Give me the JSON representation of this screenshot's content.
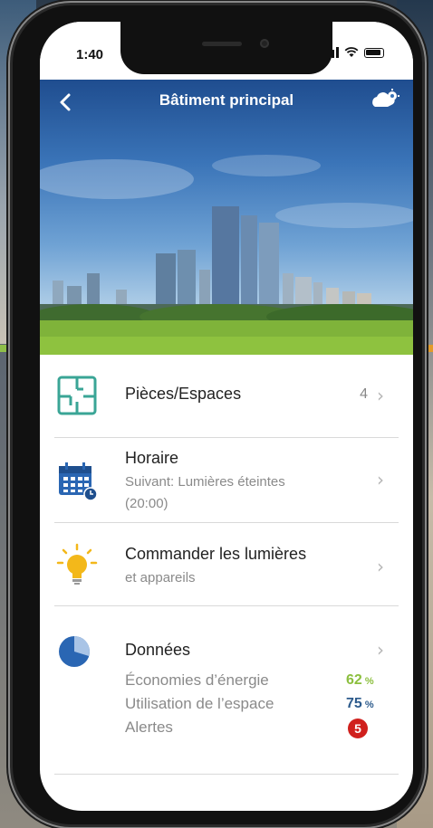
{
  "status": {
    "time": "1:40"
  },
  "header": {
    "title": "Bâtiment principal",
    "back_icon": "chevron-left-icon",
    "settings_icon": "cloud-gear-icon"
  },
  "menu": [
    {
      "title": "Pièces/Espaces",
      "count": "4",
      "icon": "floorplan-icon"
    },
    {
      "title": "Horaire",
      "subtitle_line1": "Suivant: Lumières éteintes",
      "subtitle_line2": "(20:00)",
      "icon": "calendar-icon"
    },
    {
      "title": "Commander les lumières",
      "subtitle": "et appareils",
      "icon": "lightbulb-icon"
    },
    {
      "title": "Données",
      "icon": "pie-chart-icon"
    }
  ],
  "stats": {
    "energy_label": "Économies d’énergie",
    "energy_value": "62",
    "space_label": "Utilisation de l’espace",
    "space_value": "75",
    "percent": "%",
    "alerts_label": "Alertes",
    "alerts_count": "5"
  },
  "colors": {
    "accent_green": "#8cbf3f",
    "accent_blue": "#2d5b8c",
    "alert_red": "#d0201d",
    "icon_teal": "#3aa596",
    "icon_blue": "#2a66b3",
    "icon_yellow": "#f3b81a"
  }
}
